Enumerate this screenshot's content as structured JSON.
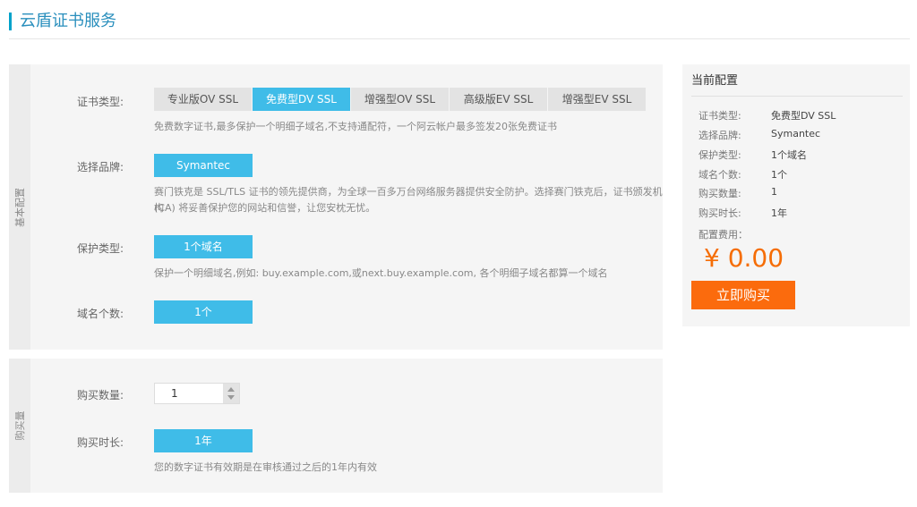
{
  "header": {
    "title": "云盾证书服务"
  },
  "basic": {
    "section_label": "基本配置",
    "cert_type": {
      "label": "证书类型:",
      "tabs": [
        "专业版OV SSL",
        "免费型DV SSL",
        "增强型OV SSL",
        "高级版EV SSL",
        "增强型EV SSL"
      ],
      "active_index": 1,
      "desc": "免费数字证书,最多保护一个明细子域名,不支持通配符，一个阿云帐户最多签发20张免费证书"
    },
    "brand": {
      "label": "选择品牌:",
      "value": "Symantec",
      "desc_line1": "赛门铁克是 SSL/TLS 证书的领先提供商，为全球一百多万台网络服务器提供安全防护。选择赛门铁克后，证书颁发机构",
      "desc_line2": "(CA) 将妥善保护您的网站和信誉，让您安枕无忧。"
    },
    "protect": {
      "label": "保护类型:",
      "value": "1个域名",
      "desc": "保护一个明细域名,例如: buy.example.com,或next.buy.example.com, 各个明细子域名都算一个域名"
    },
    "domains": {
      "label": "域名个数:",
      "value": "1个"
    }
  },
  "purchase": {
    "section_label": "购买量",
    "quantity": {
      "label": "购买数量:",
      "value": "1"
    },
    "duration": {
      "label": "购买时长:",
      "value": "1年",
      "desc": "您的数字证书有效期是在审核通过之后的1年内有效"
    }
  },
  "summary": {
    "title": "当前配置",
    "rows": [
      {
        "k": "证书类型:",
        "v": "免费型DV SSL"
      },
      {
        "k": "选择品牌:",
        "v": "Symantec"
      },
      {
        "k": "保护类型:",
        "v": "1个域名"
      },
      {
        "k": "域名个数:",
        "v": "1个"
      },
      {
        "k": "购买数量:",
        "v": "1"
      },
      {
        "k": "购买时长:",
        "v": "1年"
      }
    ],
    "fee_label": "配置费用：",
    "price": "¥ 0.00",
    "buy_label": "立即购买"
  },
  "colors": {
    "accent": "#3fbce8",
    "buy": "#fb6b0d",
    "price": "#f56d06"
  }
}
